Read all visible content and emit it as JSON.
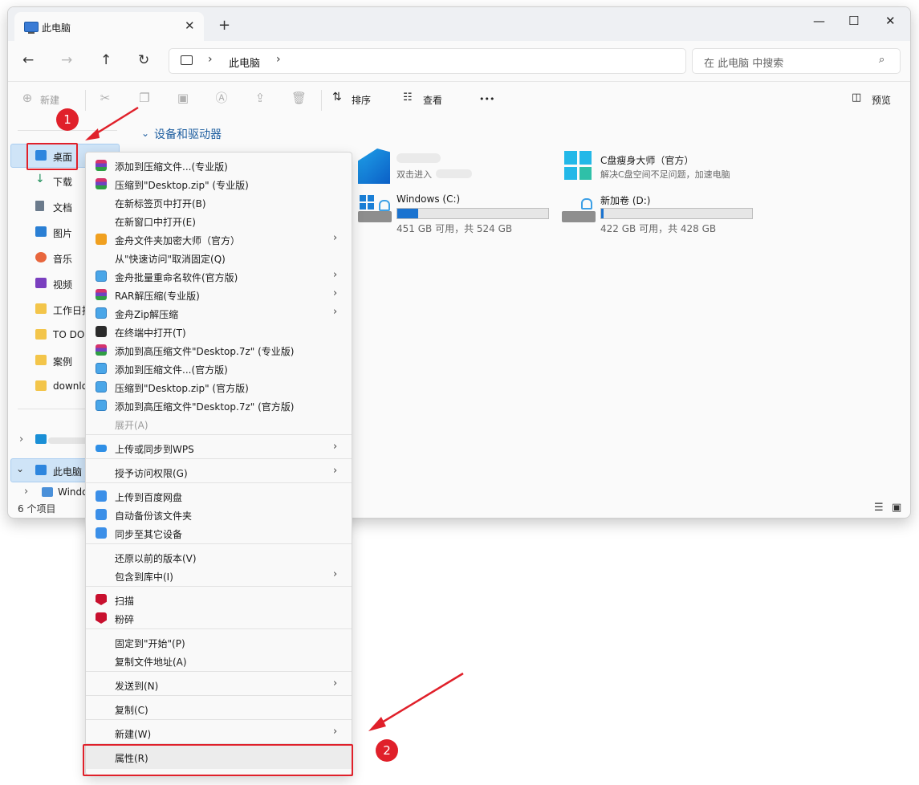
{
  "tab": {
    "title": "此电脑",
    "close": "✕"
  },
  "newtab": "+",
  "window_controls": {
    "minimize": "—",
    "maximize": "☐",
    "close": "✕"
  },
  "nav": {
    "back": "←",
    "forward": "→",
    "up": "↑",
    "refresh": "↻"
  },
  "address": {
    "chev": "›",
    "location": "此电脑"
  },
  "search": {
    "placeholder": "在 此电脑 中搜索",
    "icon": "search-icon"
  },
  "toolbar": {
    "new_label": "新建",
    "sort_label": "排序",
    "view_label": "查看",
    "more": "•••",
    "preview_label": "预览"
  },
  "sidebar": {
    "items": [
      {
        "label": "桌面"
      },
      {
        "label": "下载"
      },
      {
        "label": "文档"
      },
      {
        "label": "图片"
      },
      {
        "label": "音乐"
      },
      {
        "label": "视频"
      },
      {
        "label": "工作日报"
      },
      {
        "label": "TO DO"
      },
      {
        "label": "案例"
      },
      {
        "label": "downlo"
      }
    ],
    "thispc": "此电脑",
    "windows": "Windo"
  },
  "status": {
    "count": "6 个项目"
  },
  "content": {
    "section_title": "设备和驱动器",
    "tile1_sub": "双击进入",
    "tile2_title": "C盘瘦身大师（官方）",
    "tile2_sub": "解决C盘空间不足问题，加速电脑",
    "drive_c": {
      "name": "Windows (C:)",
      "info": "451 GB 可用，共 524 GB",
      "used_fraction": 0.14
    },
    "drive_d": {
      "name": "新加卷 (D:)",
      "info": "422 GB 可用，共 428 GB",
      "used_fraction": 0.014
    }
  },
  "menu": {
    "items": [
      "添加到压缩文件...(专业版)",
      "压缩到\"Desktop.zip\" (专业版)",
      "在新标签页中打开(B)",
      "在新窗口中打开(E)",
      "金舟文件夹加密大师（官方）",
      "从\"快速访问\"取消固定(Q)",
      "金舟批量重命名软件(官方版)",
      "RAR解压缩(专业版)",
      "金舟Zip解压缩",
      "在终端中打开(T)",
      "添加到高压缩文件\"Desktop.7z\" (专业版)",
      "添加到压缩文件...(官方版)",
      "压缩到\"Desktop.zip\" (官方版)",
      "添加到高压缩文件\"Desktop.7z\" (官方版)",
      "展开(A)",
      "上传或同步到WPS",
      "授予访问权限(G)",
      "上传到百度网盘",
      "自动备份该文件夹",
      "同步至其它设备",
      "还原以前的版本(V)",
      "包含到库中(I)",
      "扫描",
      "粉碎",
      "固定到\"开始\"(P)",
      "复制文件地址(A)",
      "发送到(N)",
      "复制(C)",
      "新建(W)",
      "属性(R)"
    ],
    "arrow": "›"
  },
  "annotations": {
    "one": "1",
    "two": "2"
  },
  "colors": {
    "accent": "#1a73d0",
    "callout": "#e0202a",
    "selection": "#cfe4f7"
  }
}
